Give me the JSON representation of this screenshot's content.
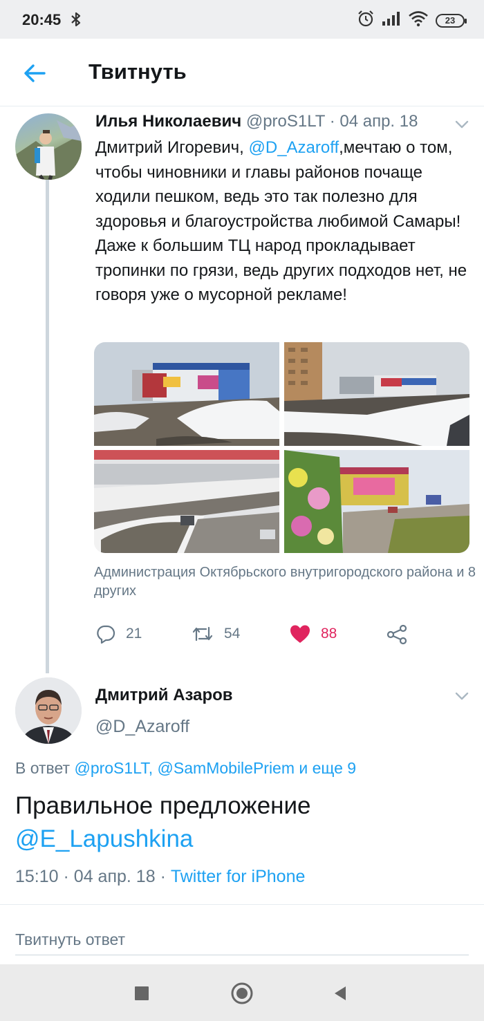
{
  "status_bar": {
    "time": "20:45",
    "battery": "23",
    "icons": [
      "bluetooth-icon",
      "alarm-icon",
      "signal-icon",
      "wifi-icon",
      "battery-icon"
    ]
  },
  "header": {
    "title": "Твитнуть",
    "back_icon": "arrow-left-icon"
  },
  "colors": {
    "accent": "#1da1f2",
    "like": "#e0245e",
    "muted": "#657786",
    "text": "#14171a"
  },
  "tweet1": {
    "name": "Илья Николаевич",
    "handle": "@proS1LT",
    "separator": "·",
    "date": "04 апр. 18",
    "text_before": "Дмитрий Игоревич, ",
    "mention": "@D_Azaroff",
    "text_after": ",мечтаю о том, чтобы чиновники и главы районов почаще ходили пешком, ведь это так полезно для здоровья и благоустройства любимой Самары! Даже к большим ТЦ народ прокладывает тропинки по грязи, ведь других подходов нет, не говоря уже о мусорной рекламе!",
    "tagged": "Администрация Октябрьского внутригородского района и 8 других",
    "replies": "21",
    "retweets": "54",
    "likes": "88"
  },
  "tweet2": {
    "name": "Дмитрий Азаров",
    "handle": "@D_Azaroff",
    "replying_prefix": "В ответ ",
    "replying_to": "@proS1LT, @SamMobilePriem",
    "replying_more": " и еще 9",
    "text": "Правильное предложение",
    "mention": "@E_Lapushkina",
    "time": "15:10",
    "separator": "·",
    "date": "04 апр. 18",
    "separator2": "·",
    "source": "Twitter for iPhone"
  },
  "reply_box": {
    "placeholder": "Твитнуть ответ"
  }
}
